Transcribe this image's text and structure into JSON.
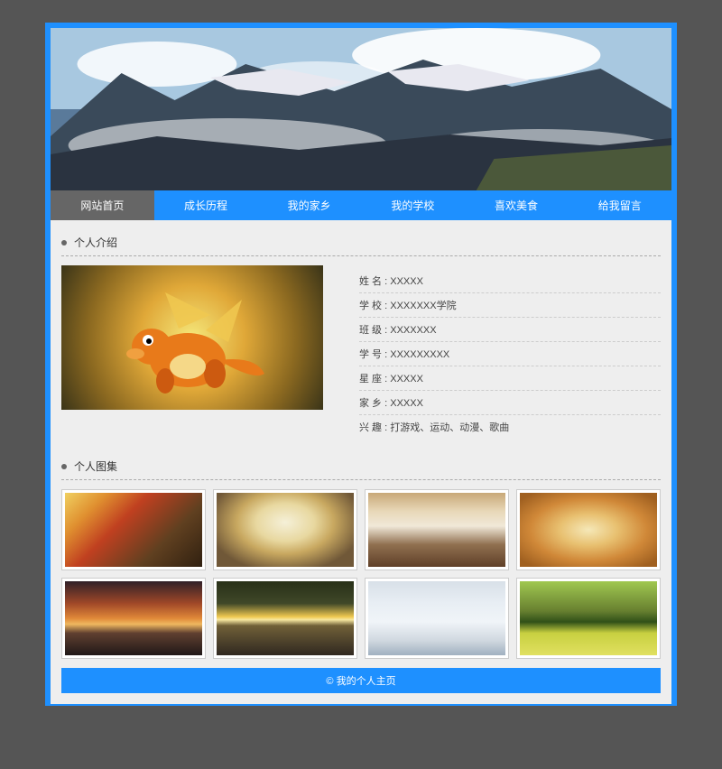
{
  "nav": [
    {
      "label": "网站首页",
      "active": true
    },
    {
      "label": "成长历程",
      "active": false
    },
    {
      "label": "我的家乡",
      "active": false
    },
    {
      "label": "我的学校",
      "active": false
    },
    {
      "label": "喜欢美食",
      "active": false
    },
    {
      "label": "给我留言",
      "active": false
    }
  ],
  "sections": {
    "intro_title": "个人介绍",
    "gallery_title": "个人图集"
  },
  "profile": {
    "name_label": "姓 名 :",
    "name_value": "XXXXX",
    "school_label": "学 校 :",
    "school_value": "XXXXXXX学院",
    "class_label": "班 级 :",
    "class_value": "XXXXXXX",
    "id_label": "学 号 :",
    "id_value": "XXXXXXXXX",
    "zodiac_label": "星 座 :",
    "zodiac_value": "XXXXX",
    "hometown_label": "家 乡 :",
    "hometown_value": "XXXXX",
    "hobby_label": "兴 趣 :",
    "hobby_value": "打游戏、运动、动漫、歌曲"
  },
  "footer": "© 我的个人主页"
}
